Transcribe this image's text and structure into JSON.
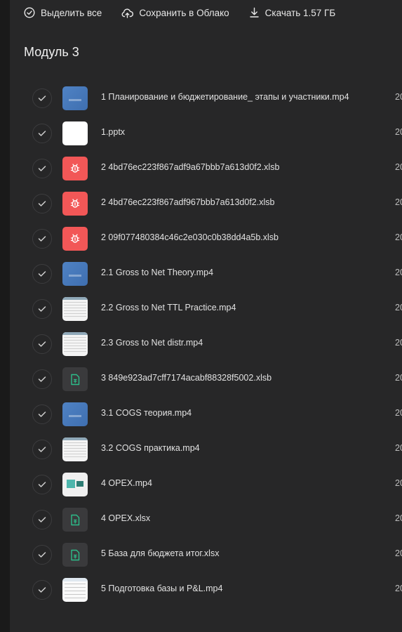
{
  "toolbar": {
    "select_all": "Выделить все",
    "save_to_cloud": "Сохранить в Облако",
    "download": "Скачать 1.57 ГБ"
  },
  "section_title": "Модуль 3",
  "files": [
    {
      "name": "1 Планирование и бюджетирование_ этапы и участники.mp4",
      "date": "20",
      "thumb": "video"
    },
    {
      "name": "1.pptx",
      "date": "20",
      "thumb": "white"
    },
    {
      "name": "2 4bd76ec223f867adf9a67bbb7a613d0f2.xlsb",
      "date": "20",
      "thumb": "red-cog"
    },
    {
      "name": "2 4bd76ec223f867adf967bbb7a613d0f2.xlsb",
      "date": "20",
      "thumb": "red-cog"
    },
    {
      "name": "2 09f077480384c46c2e030c0b38dd4a5b.xlsb",
      "date": "20",
      "thumb": "red-cog"
    },
    {
      "name": "2.1 Gross to Net Theory.mp4",
      "date": "20",
      "thumb": "video"
    },
    {
      "name": "2.2 Gross to Net TTL Practice.mp4",
      "date": "20",
      "thumb": "sheet"
    },
    {
      "name": "2.3 Gross to Net distr.mp4",
      "date": "20",
      "thumb": "sheet"
    },
    {
      "name": "3 849e923ad7cff7174acabf88328f5002.xlsb",
      "date": "20",
      "thumb": "green-file"
    },
    {
      "name": "3.1 COGS теория.mp4",
      "date": "20",
      "thumb": "video"
    },
    {
      "name": "3.2 COGS практика.mp4",
      "date": "20",
      "thumb": "sheet"
    },
    {
      "name": "4 OPEX.mp4",
      "date": "20",
      "thumb": "opex"
    },
    {
      "name": "4 OPEX.xlsx",
      "date": "20",
      "thumb": "green-file"
    },
    {
      "name": "5 База для бюджета итог.xlsx",
      "date": "20",
      "thumb": "green-file"
    },
    {
      "name": "5 Подготовка базы и P&L.mp4",
      "date": "20",
      "thumb": "doc"
    }
  ],
  "colors": {
    "background": "#272728",
    "red_thumb": "#f25757",
    "green_icon": "#2dbd8a",
    "video_thumb": "#4f82c4"
  }
}
